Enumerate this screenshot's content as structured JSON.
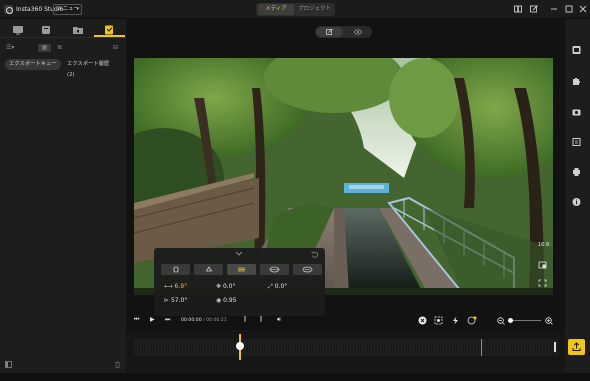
{
  "app": {
    "title": "Insta360 Studio",
    "menu_label": "メニュー"
  },
  "header": {
    "tabs": [
      {
        "label": "メディア",
        "active": true
      },
      {
        "label": "プロジェクト",
        "active": false
      }
    ]
  },
  "left_panel": {
    "export_tabs": [
      {
        "label": "エクスポートキュー",
        "active": true
      },
      {
        "label": "エクスポート履歴 (2)",
        "active": false
      }
    ]
  },
  "viewer": {
    "aspect_ratio": "16:9",
    "adjust": {
      "params": [
        {
          "icon": "pan-icon",
          "value": "6.9°",
          "highlight": true
        },
        {
          "icon": "tilt-icon",
          "value": "0.0°",
          "highlight": false
        },
        {
          "icon": "roll-icon",
          "value": "0.0°",
          "highlight": false
        },
        {
          "icon": "fov-icon",
          "value": "57.0°",
          "highlight": false
        },
        {
          "icon": "distance-icon",
          "value": "0.95",
          "highlight": false
        }
      ]
    }
  },
  "playback": {
    "current": "00:00:00",
    "total": "00:00:21"
  },
  "colors": {
    "accent": "#f0c419",
    "background": "#161616",
    "panel": "#1d1d1d"
  }
}
